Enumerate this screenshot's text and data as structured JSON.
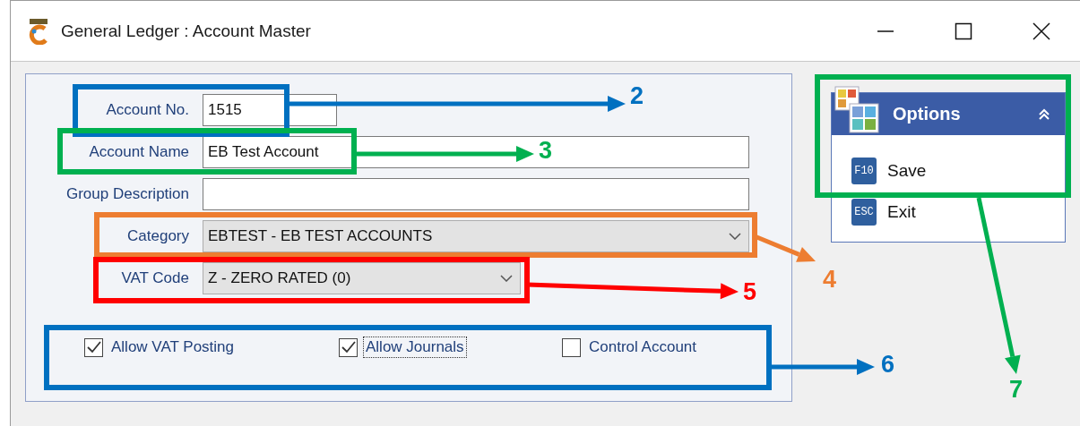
{
  "window": {
    "title": "General Ledger : Account Master"
  },
  "form": {
    "fields": [
      {
        "label": "Account No.",
        "value": "1515",
        "kind": "text"
      },
      {
        "label": "Account Name",
        "value": "EB Test Account",
        "kind": "text"
      },
      {
        "label": "Group Description",
        "kind": "text"
      },
      {
        "label": "Category",
        "value": "EBTEST - EB TEST ACCOUNTS",
        "kind": "combo"
      },
      {
        "label": "VAT Code",
        "value": "Z - ZERO RATED (0)",
        "kind": "combo"
      }
    ],
    "checkboxes": [
      {
        "label": "Allow VAT Posting",
        "checked": true,
        "focused": false
      },
      {
        "label": "Allow Journals",
        "checked": true,
        "focused": true
      },
      {
        "label": "Control Account",
        "checked": false,
        "focused": false
      }
    ]
  },
  "options": {
    "title": "Options",
    "expanded": true,
    "items": [
      {
        "key": "F10",
        "label": "Save"
      },
      {
        "key": "ESC",
        "label": "Exit"
      }
    ]
  },
  "annotations": [
    {
      "number": "2",
      "color": "#0070c0"
    },
    {
      "number": "3",
      "color": "#00b050"
    },
    {
      "number": "4",
      "color": "#ed7d31"
    },
    {
      "number": "5",
      "color": "#ff0000"
    },
    {
      "number": "6",
      "color": "#0070c0"
    },
    {
      "number": "7",
      "color": "#00b050"
    }
  ]
}
